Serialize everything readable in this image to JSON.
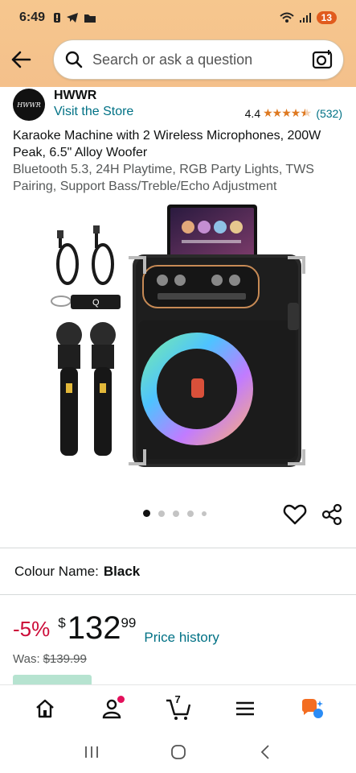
{
  "status_bar": {
    "time": "6:49",
    "battery": "13"
  },
  "header": {
    "search_placeholder": "Search or ask a question"
  },
  "brand": {
    "logo_text": "HWWR",
    "name": "HWWR",
    "visit_link": "Visit the Store",
    "rating_value": "4.4",
    "rating_stars": 4.4,
    "rating_count": "(532)"
  },
  "product": {
    "title": "Karaoke Machine with 2 Wireless Microphones, 200W Peak, 6.5\" Alloy Woofer",
    "subtitle": "Bluetooth 5.3, 24H Playtime, RGB Party Lights, TWS Pairing, Support Bass/Treble/Echo Adjustment",
    "carousel_total": 5,
    "carousel_active": 1
  },
  "colour": {
    "label": "Colour Name:",
    "value": "Black"
  },
  "price": {
    "discount": "-5%",
    "currency": "$",
    "whole": "132",
    "fraction": "99",
    "history_link": "Price history",
    "was_label": "Was:",
    "was_value": "$139.99"
  },
  "bottom_nav": {
    "cart_count": "7"
  },
  "colors": {
    "header_bg": "#f6c78e",
    "link": "#007185",
    "discount": "#cc0c39",
    "star": "#de7921"
  }
}
